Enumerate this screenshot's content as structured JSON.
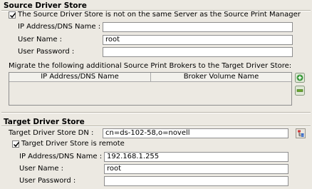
{
  "source_store": {
    "title": "Source Driver Store",
    "remote_checkbox_label": "The Source Driver Store is not on the same Server as the Source Print Manager",
    "remote_checked": true,
    "ip_label": "IP Address/DNS Name :",
    "ip_value": "",
    "user_label": "User Name :",
    "user_value": "root",
    "password_label": "User Password :",
    "password_value": "",
    "migrate_text": "Migrate the following additional Source Print Brokers to the Target Driver Store:",
    "table_columns": [
      "IP Address/DNS Name",
      "Broker Volume Name"
    ],
    "add_icon": "plus-icon",
    "remove_icon": "minus-icon",
    "colors": {
      "add": "#3c9a3c",
      "remove": "#6aa82e"
    }
  },
  "target_store": {
    "title": "Target Driver Store",
    "dn_label": "Target Driver Store DN :",
    "dn_value": "cn=ds-102-58,o=novell",
    "browse_icon": "tree-browse-icon",
    "remote_checkbox_label": "Target Driver Store is remote",
    "remote_checked": true,
    "ip_label": "IP Address/DNS Name :",
    "ip_value": "192.168.1.255",
    "user_label": "User Name :",
    "user_value": "root",
    "password_label": "User Password :",
    "password_value": ""
  }
}
